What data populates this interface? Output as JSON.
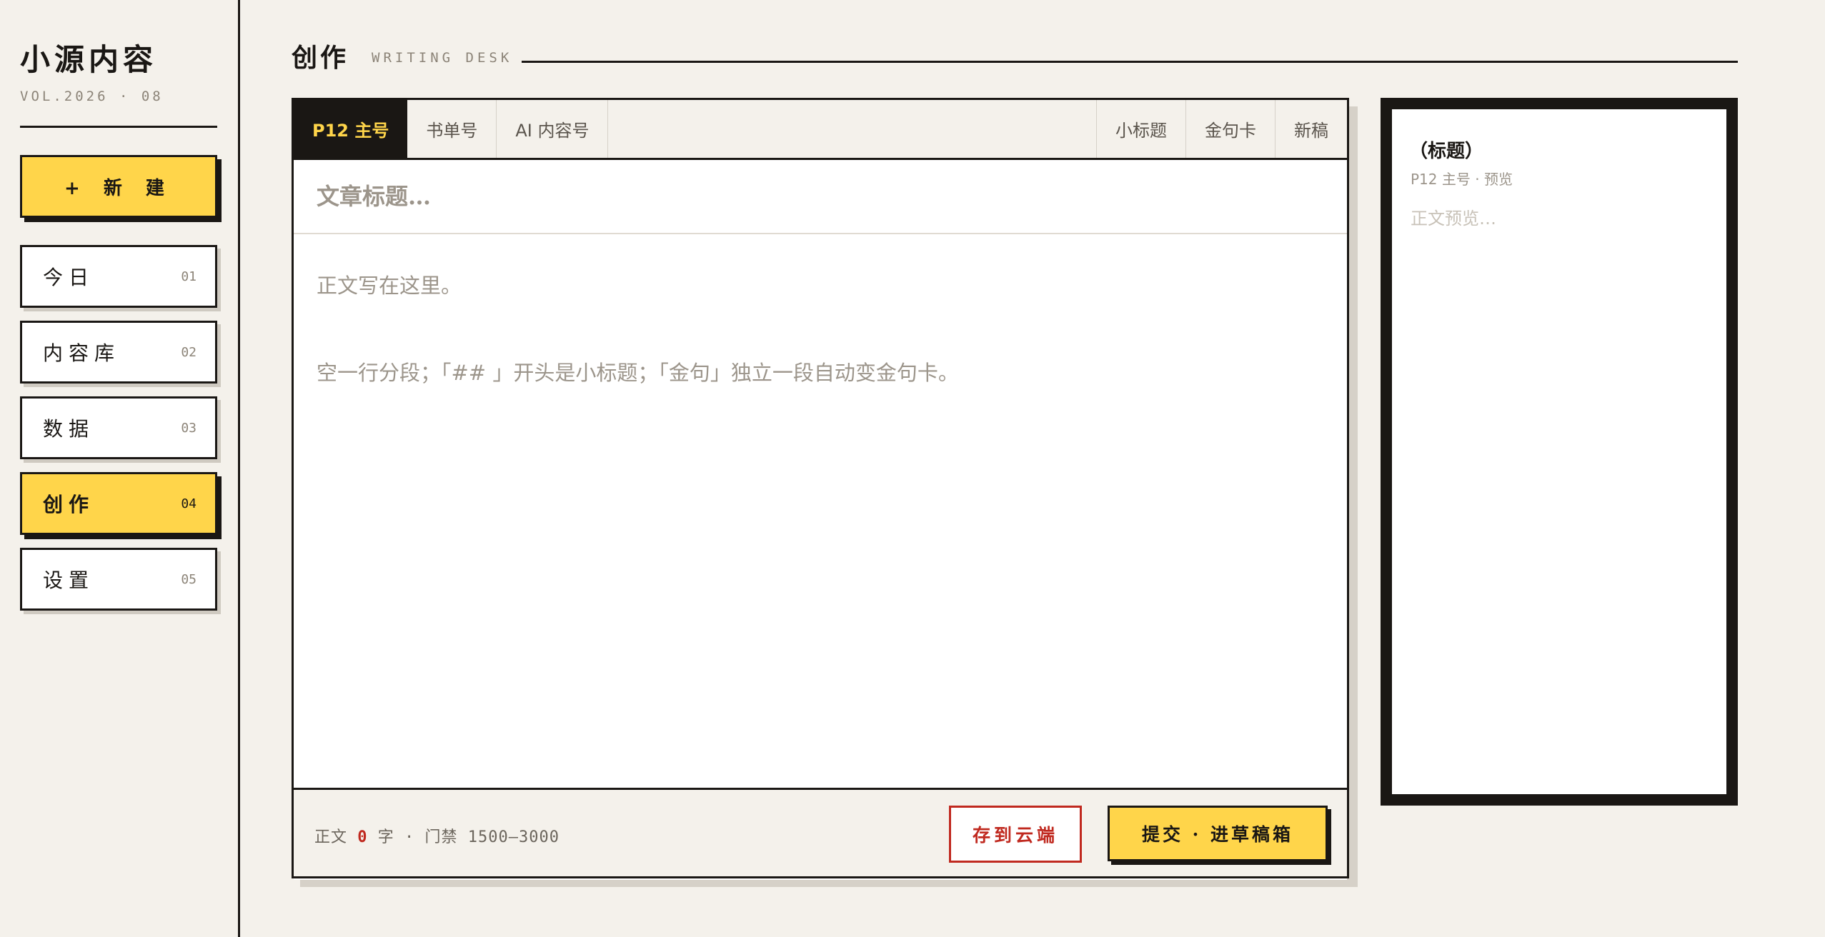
{
  "sidebar": {
    "brand": "小源内容",
    "volume": "VOL.2026 · 08",
    "new_button": "+ 新 建",
    "items": [
      {
        "label": "今日",
        "num": "01"
      },
      {
        "label": "内容库",
        "num": "02"
      },
      {
        "label": "数据",
        "num": "03"
      },
      {
        "label": "创作",
        "num": "04",
        "active": true
      },
      {
        "label": "设置",
        "num": "05"
      }
    ]
  },
  "header": {
    "title": "创作",
    "subtitle": "WRITING DESK"
  },
  "editor": {
    "tabs": [
      {
        "label": "P12 主号",
        "active": true
      },
      {
        "label": "书单号"
      },
      {
        "label": "AI 内容号"
      }
    ],
    "tools": [
      {
        "label": "小标题"
      },
      {
        "label": "金句卡"
      },
      {
        "label": "新稿"
      }
    ],
    "title_placeholder": "文章标题…",
    "body_placeholder": "正文写在这里。\n\n空一行分段；「## 」开头是小标题；「金句」独立一段自动变金句卡。",
    "word_count_prefix": "正文",
    "word_count": "0",
    "word_count_suffix": "字 · 门禁 1500—3000",
    "save_button": "存到云端",
    "submit_button": "提交 · 进草稿箱"
  },
  "preview": {
    "title": "（标题）",
    "meta": "P12 主号 · 预览",
    "body": "正文预览…"
  },
  "colors": {
    "background": "#f4f1eb",
    "ink": "#1a1714",
    "accent_yellow": "#ffd54a",
    "accent_red": "#c0291f",
    "muted": "#8c8478"
  }
}
